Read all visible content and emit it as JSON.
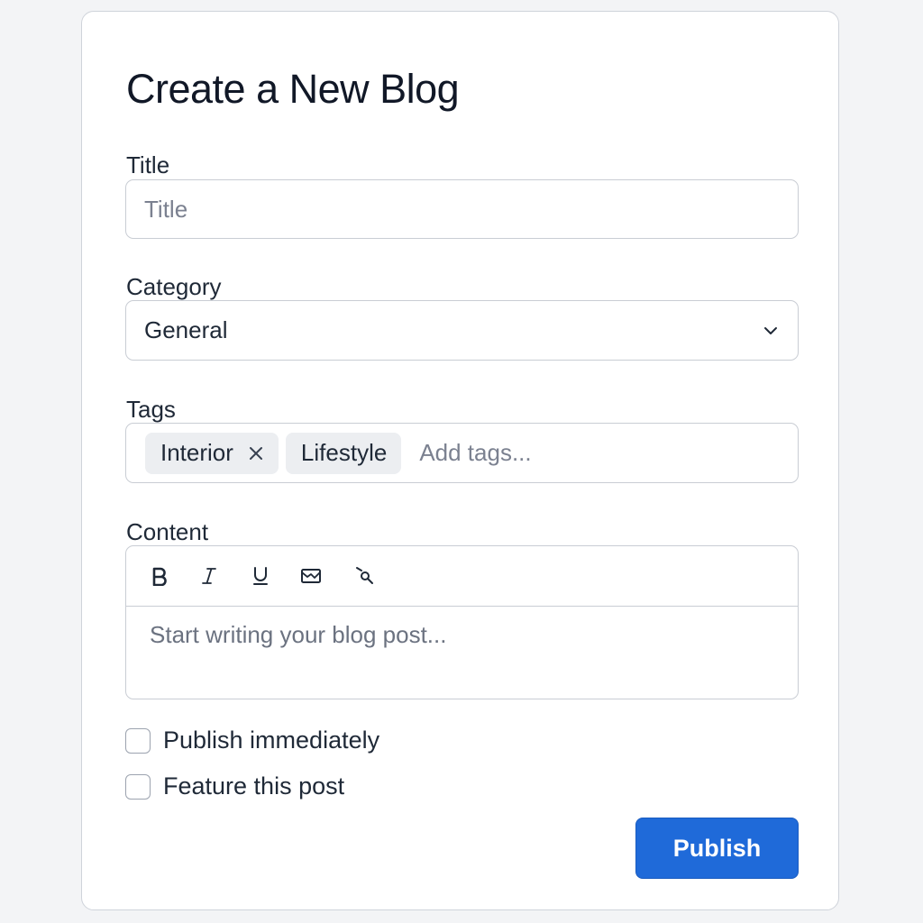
{
  "form": {
    "heading": "Create a New Blog",
    "title_field": {
      "label": "Title",
      "placeholder": "Title",
      "value": ""
    },
    "category_field": {
      "label": "Category",
      "selected": "General"
    },
    "tags_field": {
      "label": "Tags",
      "tags": [
        "Interior",
        "Lifestyle"
      ],
      "placeholder": "Add tags..."
    },
    "content_field": {
      "label": "Content",
      "toolbar": [
        "bold-icon",
        "italic-icon",
        "underline-icon",
        "image-icon",
        "link-icon"
      ],
      "placeholder": "Start writing your blog post..."
    },
    "options": {
      "publish_immediately": {
        "label": "Publish immediately",
        "checked": false
      },
      "feature_post": {
        "label": "Feature this post",
        "checked": false
      }
    },
    "submit_label": "Publish"
  },
  "colors": {
    "accent": "#1f6ad9",
    "border": "#c9cdd4",
    "background": "#f3f4f6"
  }
}
